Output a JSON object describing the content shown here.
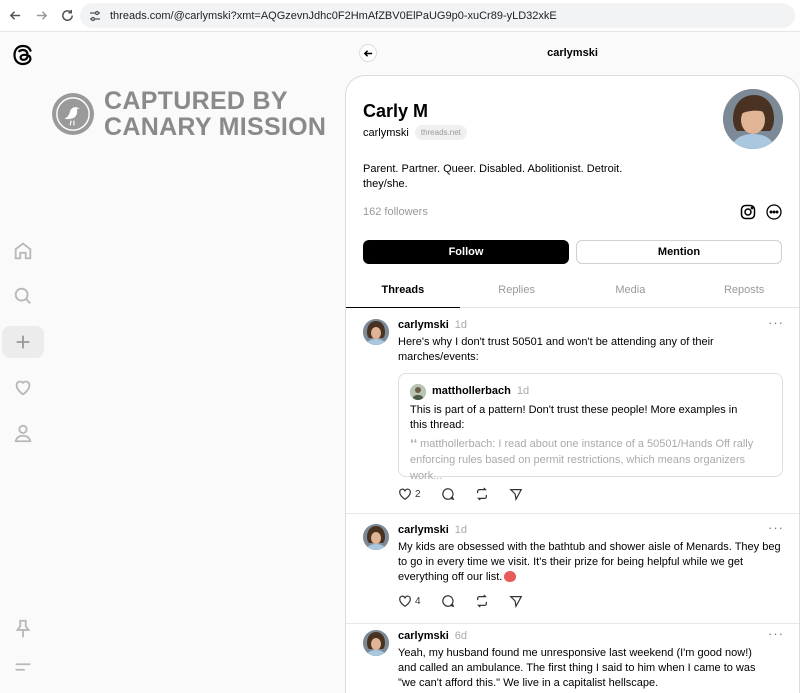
{
  "browser": {
    "url": "threads.com/@carlymski?xmt=AQGzevnJdhc0F2HmAfZBV0ElPaUG9p0-xuCr89-yLD32xkE"
  },
  "watermark": {
    "line1": "CAPTURED BY",
    "line2": "CANARY MISSION"
  },
  "header": {
    "title": "carlymski"
  },
  "profile": {
    "name": "Carly M",
    "handle": "carlymski",
    "chip": "threads.net",
    "bio_line1": "Parent. Partner. Queer. Disabled. Abolitionist. Detroit.",
    "bio_line2": "they/she.",
    "followers": "162 followers",
    "follow_label": "Follow",
    "mention_label": "Mention"
  },
  "tabs": [
    {
      "label": "Threads"
    },
    {
      "label": "Replies"
    },
    {
      "label": "Media"
    },
    {
      "label": "Reposts"
    }
  ],
  "posts": [
    {
      "user": "carlymski",
      "time": "1d",
      "text": "Here's why I don't trust 50501 and won't be attending any of their marches/events:",
      "quote": {
        "user": "matthollerbach",
        "time": "1d",
        "text": "This is part of a pattern! Don't trust these people! More examples in this thread:",
        "sub": "❛❛ matthollerbach: I read about one instance of a 50501/Hands Off rally enforcing rules based on permit restrictions, which means organizers work..."
      },
      "likes": "2"
    },
    {
      "user": "carlymski",
      "time": "1d",
      "text": "My kids are obsessed with the bathtub and shower aisle of Menards. They beg to go in every time we visit. It's their prize for being helpful while we get everything off our list.",
      "likes": "4"
    },
    {
      "user": "carlymski",
      "time": "6d",
      "text": "Yeah, my husband found me unresponsive last weekend (I'm good now!) and called an ambulance. The first thing I said to him when I came to was \"we can't afford this.\" We live in a capitalist hellscape."
    }
  ]
}
